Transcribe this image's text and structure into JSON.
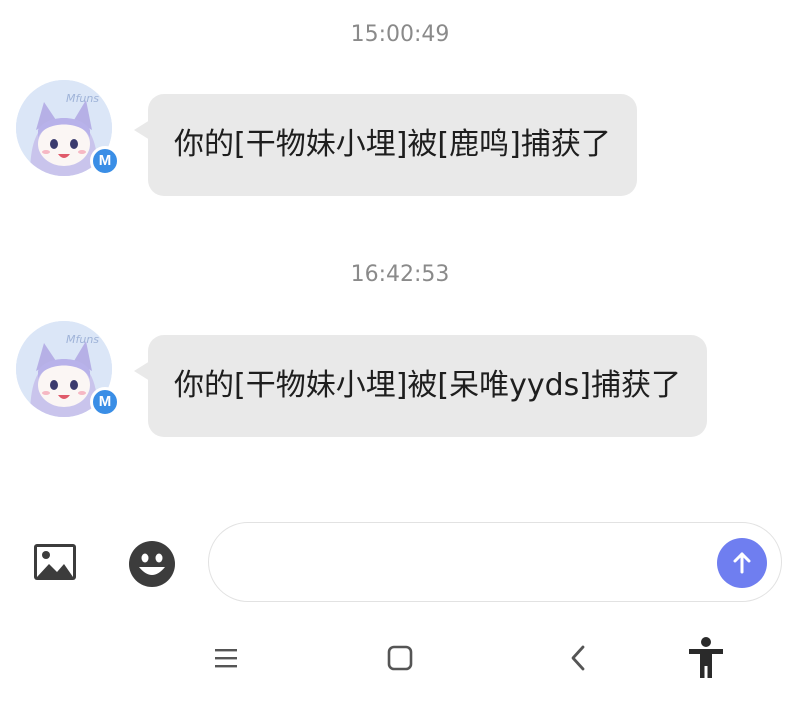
{
  "conversation": {
    "messages": [
      {
        "timestamp": "15:00:49",
        "sender_badge": "M",
        "avatar_label": "Mfuns",
        "text": "你的[干物妹小埋]被[鹿鸣]捕获了"
      },
      {
        "timestamp": "16:42:53",
        "sender_badge": "M",
        "avatar_label": "Mfuns",
        "text": "你的[干物妹小埋]被[呆唯yyds]捕获了"
      }
    ]
  },
  "composer": {
    "input_value": "",
    "image_icon": "image-icon",
    "emoji_icon": "emoji-icon",
    "send_icon": "arrow-up-icon"
  },
  "nav": {
    "menu_icon": "menu-icon",
    "home_icon": "square-home-icon",
    "back_icon": "back-chevron-icon",
    "accessibility_icon": "accessibility-icon"
  },
  "colors": {
    "bubble": "#e9e9e9",
    "send_button": "#6f7ef0",
    "badge": "#3a8ee6",
    "timestamp": "#8a8a8a"
  }
}
